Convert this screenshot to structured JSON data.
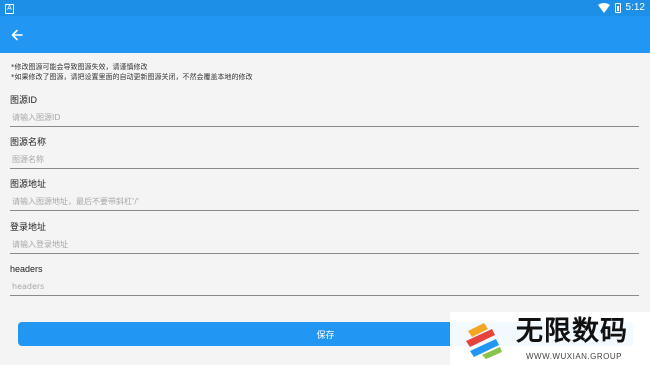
{
  "status_bar": {
    "app_icon_letter": "A",
    "time": "5:12",
    "wifi_icon": "wifi-icon",
    "battery_icon": "battery-icon"
  },
  "toolbar": {
    "back_icon": "arrow-left-icon"
  },
  "notes": {
    "line1": "*修改图源可能会导致图源失效，请谨慎修改",
    "line2": "*如果修改了图源，请把设置里面的自动更新图源关闭，不然会覆盖本地的修改"
  },
  "form": {
    "fields": [
      {
        "label": "图源ID",
        "placeholder": "请输入图源ID",
        "value": ""
      },
      {
        "label": "图源名称",
        "placeholder": "图源名称",
        "value": ""
      },
      {
        "label": "图源地址",
        "placeholder": "请输入图源地址，最后不要带斜杠'/'",
        "value": ""
      },
      {
        "label": "登录地址",
        "placeholder": "请输入登录地址",
        "value": ""
      },
      {
        "label": "headers",
        "placeholder": "headers",
        "value": ""
      }
    ],
    "save_label": "保存"
  },
  "watermark": {
    "title": "无限数码",
    "url": "WWW.WUXIAN.GROUP"
  },
  "colors": {
    "primary": "#2196f3",
    "status_bar": "#1e8fe6",
    "background": "#f4f4f4"
  }
}
